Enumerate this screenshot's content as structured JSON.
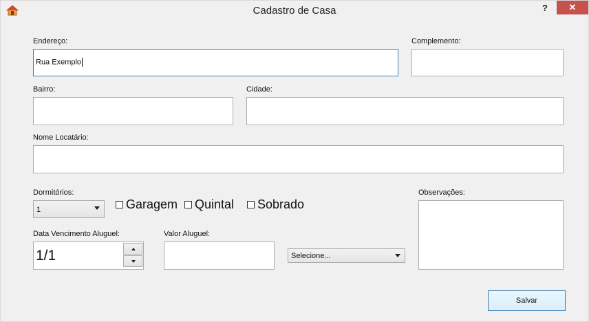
{
  "window": {
    "title": "Cadastro de Casa",
    "help": "?",
    "close": "✕"
  },
  "form": {
    "endereco": {
      "label": "Endereço:",
      "value": "Rua Exemplo"
    },
    "complemento": {
      "label": "Complemento:",
      "value": ""
    },
    "bairro": {
      "label": "Bairro:",
      "value": ""
    },
    "cidade": {
      "label": "Cidade:",
      "value": ""
    },
    "nome_locatario": {
      "label": "Nome Locatário:",
      "value": ""
    },
    "dormitorios": {
      "label": "Dormitórios:",
      "selected": "1"
    },
    "checkboxes": {
      "garagem": "Garagem",
      "quintal": "Quintal",
      "sobrado": "Sobrado"
    },
    "observacoes": {
      "label": "Observações:",
      "value": ""
    },
    "data_vencimento": {
      "label": "Data Vencimento Aluguel:",
      "value": "1/1"
    },
    "valor_aluguel": {
      "label": "Valor Aluguel:",
      "value": ""
    },
    "tipo": {
      "selected": "Selecione..."
    }
  },
  "actions": {
    "save_label": "Salvar"
  }
}
